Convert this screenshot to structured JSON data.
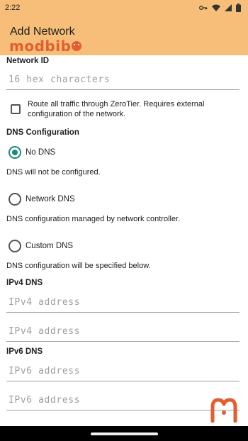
{
  "status_bar": {
    "time": "2:22",
    "icons": [
      "key-icon",
      "wifi-icon",
      "signal-icon",
      "battery-icon"
    ]
  },
  "app_bar": {
    "title": "Add Network",
    "brand": "modbib",
    "background": "#f6be78",
    "brand_color": "#e45d2e"
  },
  "form": {
    "network_id": {
      "label": "Network ID",
      "value": "",
      "placeholder": "16 hex characters"
    },
    "route_all_traffic": {
      "label": "Route all traffic through ZeroTier. Requires external configuration of the network.",
      "checked": false
    },
    "dns": {
      "label": "DNS Configuration",
      "accent": "#1b8a7a",
      "options": [
        {
          "label": "No DNS",
          "help": "DNS will not be configured.",
          "selected": true
        },
        {
          "label": "Network DNS",
          "help": "DNS configuration managed by network controller.",
          "selected": false
        },
        {
          "label": "Custom DNS",
          "help": "DNS configuration will be specified below.",
          "selected": false
        }
      ]
    },
    "ipv4": {
      "label": "IPv4 DNS",
      "fields": [
        {
          "value": "",
          "placeholder": "IPv4 address"
        },
        {
          "value": "",
          "placeholder": "IPv4 address"
        }
      ]
    },
    "ipv6": {
      "label": "IPv6 DNS",
      "fields": [
        {
          "value": "",
          "placeholder": "IPv6 address"
        },
        {
          "value": "",
          "placeholder": "IPv6 address"
        }
      ]
    }
  }
}
